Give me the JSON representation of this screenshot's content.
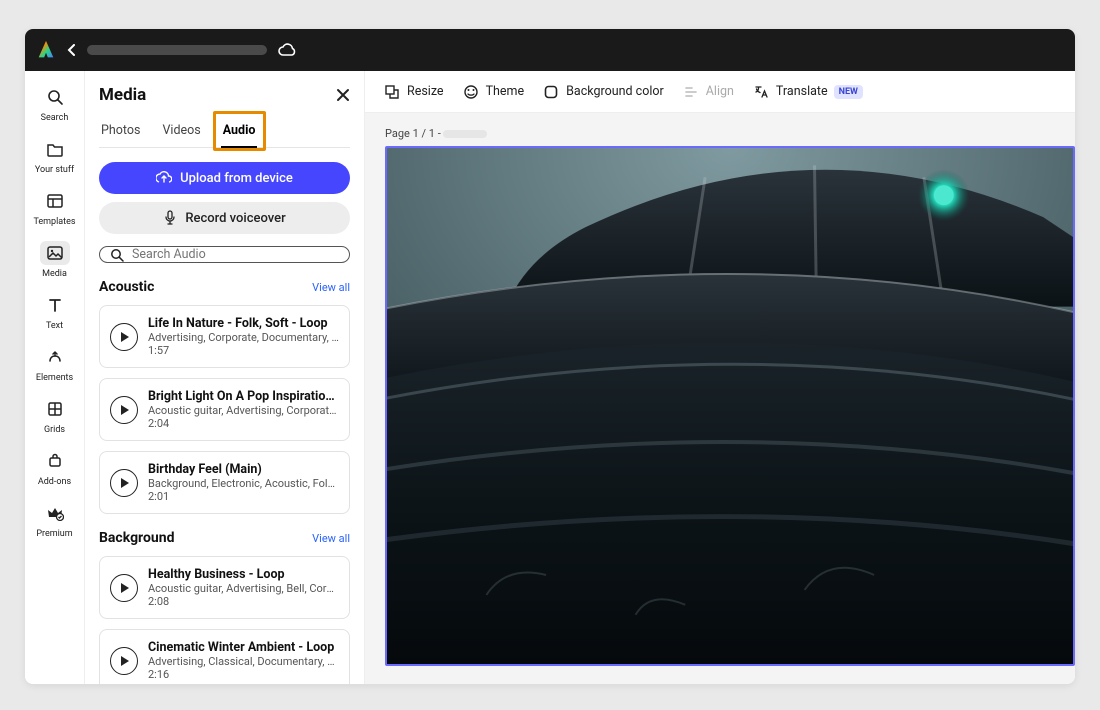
{
  "rail": [
    {
      "id": "search",
      "label": "Search"
    },
    {
      "id": "your-stuff",
      "label": "Your stuff"
    },
    {
      "id": "templates",
      "label": "Templates"
    },
    {
      "id": "media",
      "label": "Media",
      "active": true
    },
    {
      "id": "text",
      "label": "Text"
    },
    {
      "id": "elements",
      "label": "Elements"
    },
    {
      "id": "grids",
      "label": "Grids"
    },
    {
      "id": "addons",
      "label": "Add-ons"
    },
    {
      "id": "premium",
      "label": "Premium"
    }
  ],
  "panel": {
    "title": "Media",
    "tabs": [
      {
        "id": "photos",
        "label": "Photos"
      },
      {
        "id": "videos",
        "label": "Videos"
      },
      {
        "id": "audio",
        "label": "Audio",
        "active": true,
        "highlighted": true
      }
    ],
    "upload_label": "Upload from device",
    "record_label": "Record voiceover",
    "search_placeholder": "Search Audio"
  },
  "sections": [
    {
      "title": "Acoustic",
      "view_all": "View all",
      "tracks": [
        {
          "title": "Life In Nature - Folk, Soft - Loop",
          "tags": "Advertising, Corporate, Documentary, D…",
          "duration": "1:57"
        },
        {
          "title": "Bright Light On A Pop Inspiratio…",
          "tags": "Acoustic guitar, Advertising, Corporate, …",
          "duration": "2:04"
        },
        {
          "title": "Birthday Feel (Main)",
          "tags": "Background, Electronic, Acoustic, Folk, …",
          "duration": "2:01"
        }
      ]
    },
    {
      "title": "Background",
      "view_all": "View all",
      "tracks": [
        {
          "title": "Healthy Business - Loop",
          "tags": "Acoustic guitar, Advertising, Bell, Corpor…",
          "duration": "2:08"
        },
        {
          "title": "Cinematic Winter Ambient - Loop",
          "tags": "Advertising, Classical, Documentary, Dr…",
          "duration": "2:16"
        }
      ]
    }
  ],
  "toolbar": {
    "resize": "Resize",
    "theme": "Theme",
    "bgcolor": "Background color",
    "align": "Align",
    "translate": "Translate",
    "new": "NEW"
  },
  "page_label": "Page 1 / 1 -"
}
